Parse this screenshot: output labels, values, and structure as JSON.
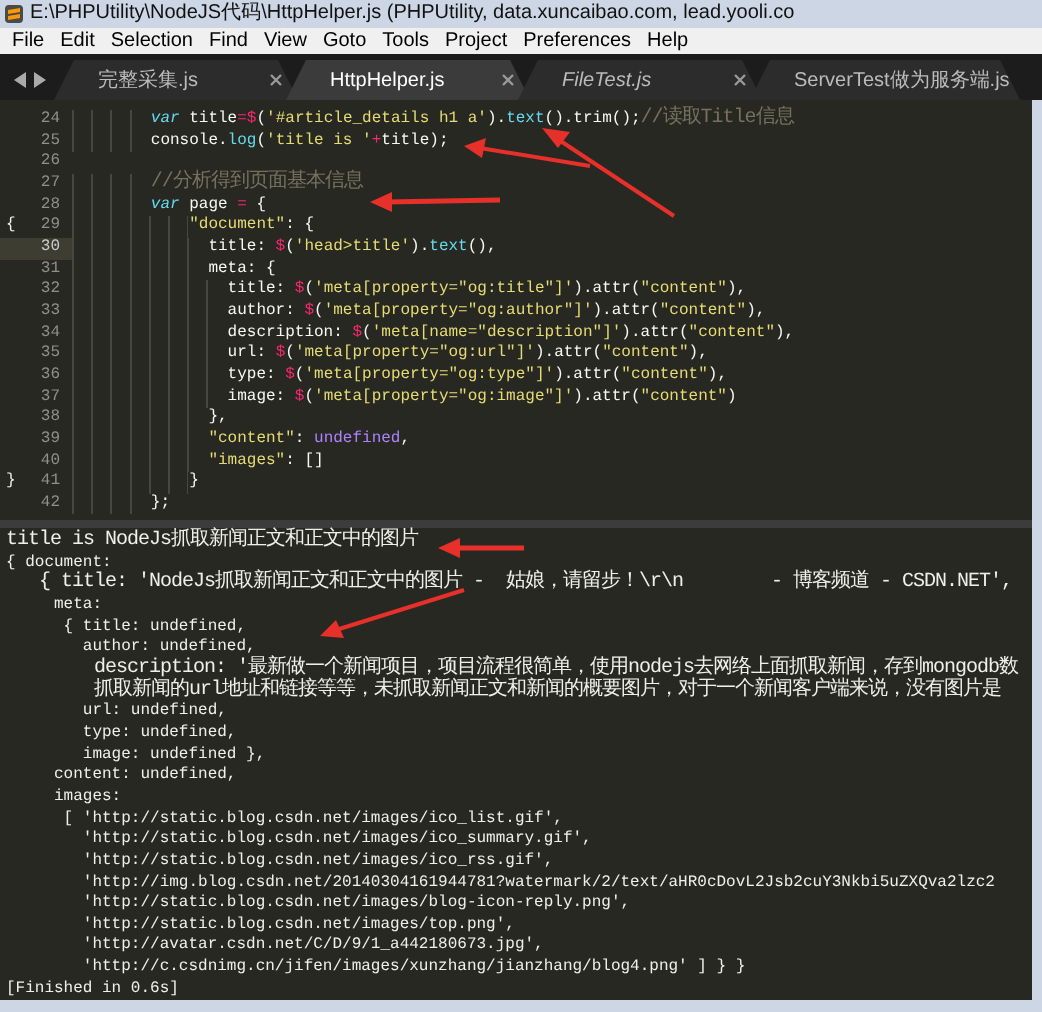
{
  "window": {
    "title": "E:\\PHPUtility\\NodeJS代码\\HttpHelper.js (PHPUtility, data.xuncaibao.com, lead.yooli.co"
  },
  "menu": [
    "File",
    "Edit",
    "Selection",
    "Find",
    "View",
    "Goto",
    "Tools",
    "Project",
    "Preferences",
    "Help"
  ],
  "tabs": [
    {
      "label": "完整采集.js",
      "selected": false,
      "preview": false
    },
    {
      "label": "HttpHelper.js",
      "selected": true,
      "preview": false
    },
    {
      "label": "FileTest.js",
      "selected": false,
      "preview": true
    },
    {
      "label": "ServerTest做为服务端.js",
      "selected": false,
      "preview": false
    }
  ],
  "editor": {
    "lines": [
      {
        "number": "24",
        "current": false,
        "segments": [
          {
            "kind": "keyword",
            "text": "        var"
          },
          {
            "kind": "plain",
            "text": " title"
          },
          {
            "kind": "operator",
            "text": "="
          },
          {
            "kind": "operator",
            "text": "$"
          },
          {
            "kind": "plain",
            "text": "("
          },
          {
            "kind": "string",
            "text": "'#article_details h1 a'"
          },
          {
            "kind": "plain",
            "text": ")."
          },
          {
            "kind": "function",
            "text": "text"
          },
          {
            "kind": "plain",
            "text": "().trim();"
          },
          {
            "kind": "comment",
            "text": "//读取Title信息"
          }
        ]
      },
      {
        "number": "25",
        "current": false,
        "segments": [
          {
            "kind": "plain",
            "text": "        console."
          },
          {
            "kind": "function",
            "text": "log"
          },
          {
            "kind": "plain",
            "text": "("
          },
          {
            "kind": "string",
            "text": "'title is '"
          },
          {
            "kind": "operator",
            "text": "+"
          },
          {
            "kind": "plain",
            "text": "title);"
          }
        ]
      },
      {
        "number": "26",
        "current": false
      },
      {
        "number": "27",
        "current": false,
        "segments": [
          {
            "kind": "comment",
            "text": "        //分析得到页面基本信息"
          }
        ]
      },
      {
        "number": "28",
        "current": false,
        "segments": [
          {
            "kind": "keyword",
            "text": "        var"
          },
          {
            "kind": "plain",
            "text": " page "
          },
          {
            "kind": "operator",
            "text": "="
          },
          {
            "kind": "plain",
            "text": " {"
          }
        ]
      },
      {
        "number": "29",
        "current": false,
        "gutter_mark": "{",
        "segments": [
          {
            "kind": "string",
            "text": "            \"document\""
          },
          {
            "kind": "plain",
            "text": ": {"
          }
        ]
      },
      {
        "number": "30",
        "current": true,
        "segments": [
          {
            "kind": "plain",
            "text": "              title: "
          },
          {
            "kind": "operator",
            "text": "$"
          },
          {
            "kind": "plain",
            "text": "("
          },
          {
            "kind": "string",
            "text": "'head>title'"
          },
          {
            "kind": "plain",
            "text": ")."
          },
          {
            "kind": "function",
            "text": "text"
          },
          {
            "kind": "plain",
            "text": "(),"
          }
        ]
      },
      {
        "number": "31",
        "current": false,
        "segments": [
          {
            "kind": "plain",
            "text": "              meta: {"
          }
        ]
      },
      {
        "number": "32",
        "current": false,
        "segments": [
          {
            "kind": "plain",
            "text": "                title: "
          },
          {
            "kind": "operator",
            "text": "$"
          },
          {
            "kind": "plain",
            "text": "("
          },
          {
            "kind": "string",
            "text": "'meta[property=\"og:title\"]'"
          },
          {
            "kind": "plain",
            "text": ").attr("
          },
          {
            "kind": "string",
            "text": "\"content\""
          },
          {
            "kind": "plain",
            "text": "),"
          }
        ]
      },
      {
        "number": "33",
        "current": false,
        "segments": [
          {
            "kind": "plain",
            "text": "                author: "
          },
          {
            "kind": "operator",
            "text": "$"
          },
          {
            "kind": "plain",
            "text": "("
          },
          {
            "kind": "string",
            "text": "'meta[property=\"og:author\"]'"
          },
          {
            "kind": "plain",
            "text": ").attr("
          },
          {
            "kind": "string",
            "text": "\"content\""
          },
          {
            "kind": "plain",
            "text": "),"
          }
        ]
      },
      {
        "number": "34",
        "current": false,
        "segments": [
          {
            "kind": "plain",
            "text": "                description: "
          },
          {
            "kind": "operator",
            "text": "$"
          },
          {
            "kind": "plain",
            "text": "("
          },
          {
            "kind": "string",
            "text": "'meta[name=\"description\"]'"
          },
          {
            "kind": "plain",
            "text": ").attr("
          },
          {
            "kind": "string",
            "text": "\"content\""
          },
          {
            "kind": "plain",
            "text": "),"
          }
        ]
      },
      {
        "number": "35",
        "current": false,
        "segments": [
          {
            "kind": "plain",
            "text": "                url: "
          },
          {
            "kind": "operator",
            "text": "$"
          },
          {
            "kind": "plain",
            "text": "("
          },
          {
            "kind": "string",
            "text": "'meta[property=\"og:url\"]'"
          },
          {
            "kind": "plain",
            "text": ").attr("
          },
          {
            "kind": "string",
            "text": "\"content\""
          },
          {
            "kind": "plain",
            "text": "),"
          }
        ]
      },
      {
        "number": "36",
        "current": false,
        "segments": [
          {
            "kind": "plain",
            "text": "                type: "
          },
          {
            "kind": "operator",
            "text": "$"
          },
          {
            "kind": "plain",
            "text": "("
          },
          {
            "kind": "string",
            "text": "'meta[property=\"og:type\"]'"
          },
          {
            "kind": "plain",
            "text": ").attr("
          },
          {
            "kind": "string",
            "text": "\"content\""
          },
          {
            "kind": "plain",
            "text": "),"
          }
        ]
      },
      {
        "number": "37",
        "current": false,
        "segments": [
          {
            "kind": "plain",
            "text": "                image: "
          },
          {
            "kind": "operator",
            "text": "$"
          },
          {
            "kind": "plain",
            "text": "("
          },
          {
            "kind": "string",
            "text": "'meta[property=\"og:image\"]'"
          },
          {
            "kind": "plain",
            "text": ").attr("
          },
          {
            "kind": "string",
            "text": "\"content\""
          },
          {
            "kind": "plain",
            "text": ")"
          }
        ]
      },
      {
        "number": "38",
        "current": false,
        "segments": [
          {
            "kind": "plain",
            "text": "              },"
          }
        ]
      },
      {
        "number": "39",
        "current": false,
        "segments": [
          {
            "kind": "string",
            "text": "              \"content\""
          },
          {
            "kind": "plain",
            "text": ": "
          },
          {
            "kind": "constant",
            "text": "undefined"
          },
          {
            "kind": "plain",
            "text": ","
          }
        ]
      },
      {
        "number": "40",
        "current": false,
        "segments": [
          {
            "kind": "string",
            "text": "              \"images\""
          },
          {
            "kind": "plain",
            "text": ": []"
          }
        ]
      },
      {
        "number": "41",
        "current": false,
        "gutter_mark": "}",
        "segments": [
          {
            "kind": "plain",
            "text": "            }"
          }
        ]
      },
      {
        "number": "42",
        "current": false,
        "segments": [
          {
            "kind": "plain",
            "text": "        };"
          }
        ]
      }
    ]
  },
  "console": {
    "lines": [
      "title is NodeJs抓取新闻正文和正文中的图片",
      "{ document:",
      "   { title: 'NodeJs抓取新闻正文和正文中的图片 -  姑娘，请留步！\\r\\n        - 博客频道 - CSDN.NET',",
      "     meta:",
      "      { title: undefined,",
      "        author: undefined,",
      "        description: '最新做一个新闻项目，项目流程很简单，使用nodejs去网络上面抓取新闻，存到mongodb数",
      "        抓取新闻的url地址和链接等等，未抓取新闻正文和新闻的概要图片，对于一个新闻客户端来说，没有图片是",
      "        url: undefined,",
      "        type: undefined,",
      "        image: undefined },",
      "     content: undefined,",
      "     images:",
      "      [ 'http://static.blog.csdn.net/images/ico_list.gif',",
      "        'http://static.blog.csdn.net/images/ico_summary.gif',",
      "        'http://static.blog.csdn.net/images/ico_rss.gif',",
      "        'http://img.blog.csdn.net/20140304161944781?watermark/2/text/aHR0cDovL2Jsb2cuY3Nkbi5uZXQva2lzc2",
      "        'http://static.blog.csdn.net/images/blog-icon-reply.png',",
      "        'http://static.blog.csdn.net/images/top.png',",
      "        'http://avatar.csdn.net/C/D/9/1_a442180673.jpg',",
      "        'http://c.csdnimg.cn/jifen/images/xunzhang/jianzhang/blog4.png' ] } }",
      "[Finished in 0.6s]"
    ]
  }
}
